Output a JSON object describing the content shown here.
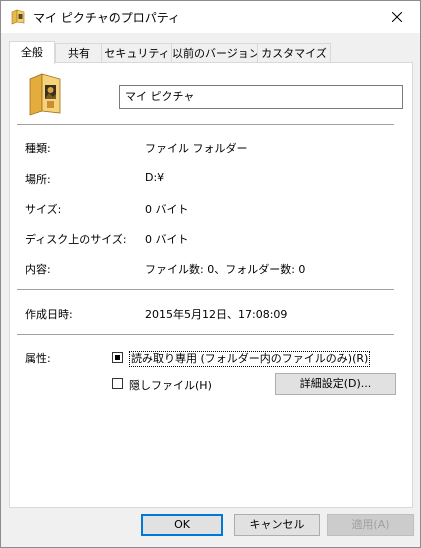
{
  "window": {
    "title": "マイ ピクチャのプロパティ"
  },
  "tabs": [
    {
      "label": "全般"
    },
    {
      "label": "共有"
    },
    {
      "label": "セキュリティ"
    },
    {
      "label": "以前のバージョン"
    },
    {
      "label": "カスタマイズ"
    }
  ],
  "general": {
    "name_value": "マイ ピクチャ",
    "rows": [
      {
        "label": "種類:",
        "value": "ファイル フォルダー"
      },
      {
        "label": "場所:",
        "value": "D:¥"
      },
      {
        "label": "サイズ:",
        "value": "0 バイト"
      },
      {
        "label": "ディスク上のサイズ:",
        "value": "0 バイト"
      },
      {
        "label": "内容:",
        "value": "ファイル数: 0、フォルダー数: 0"
      }
    ],
    "created_label": "作成日時:",
    "created_value": "2015年5月12日、17:08:09",
    "attributes_label": "属性:",
    "readonly_label": "読み取り専用 (フォルダー内のファイルのみ)(R)",
    "readonly_state": "indeterminate",
    "hidden_label": "隠しファイル(H)",
    "hidden_state": "unchecked",
    "advanced_button": "詳細設定(D)..."
  },
  "footer": {
    "ok": "OK",
    "cancel": "キャンセル",
    "apply": "適用(A)"
  }
}
